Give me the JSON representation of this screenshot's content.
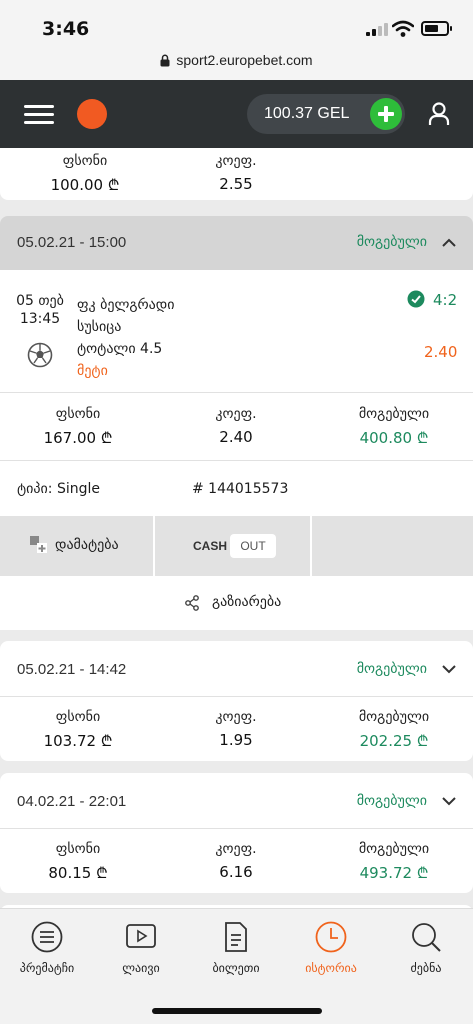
{
  "status_bar": {
    "time": "3:46",
    "url": "sport2.europebet.com"
  },
  "header": {
    "balance": "100.37 GEL"
  },
  "labels": {
    "stake": "ფსონი",
    "odds": "კოეფ.",
    "won": "მოგებული"
  },
  "top_partial": {
    "stake": "100.00 ₾",
    "odds": "2.55"
  },
  "expanded_bet": {
    "date": "05.02.21 - 15:00",
    "status": "მოგებული",
    "event": {
      "day": "05 თებ",
      "time": "13:45",
      "home_team": "ფკ ბელგრადი",
      "away_team": "სუსიცა",
      "market": "ტოტალი 4.5",
      "selection": "მეტი",
      "score": "4:2",
      "odds": "2.40"
    },
    "stake": "167.00 ₾",
    "odds": "2.40",
    "won": "400.80 ₾",
    "type_label": "ტიპი:",
    "type": "Single",
    "ticket_id": "# 144015573",
    "actions": {
      "add": "დამატება",
      "cash": "CASH",
      "out": "OUT",
      "share": "გაზიარება"
    }
  },
  "bets": [
    {
      "date": "05.02.21 - 14:42",
      "status": "მოგებული",
      "stake": "103.72 ₾",
      "odds": "1.95",
      "won": "202.25 ₾"
    },
    {
      "date": "04.02.21 - 22:01",
      "status": "მოგებული",
      "stake": "80.15 ₾",
      "odds": "6.16",
      "won": "493.72 ₾"
    }
  ],
  "tabs": [
    {
      "label": "პრემატჩი",
      "icon": "list-icon"
    },
    {
      "label": "ლაივი",
      "icon": "play-icon"
    },
    {
      "label": "ბილეთი",
      "icon": "document-icon"
    },
    {
      "label": "ისტორია",
      "icon": "clock-icon",
      "active": true
    },
    {
      "label": "ძებნა",
      "icon": "search-icon"
    }
  ],
  "colors": {
    "accent": "#f0631c",
    "won": "#1d8a5e",
    "header": "#2d3133",
    "add_money": "#2ebd3a"
  }
}
